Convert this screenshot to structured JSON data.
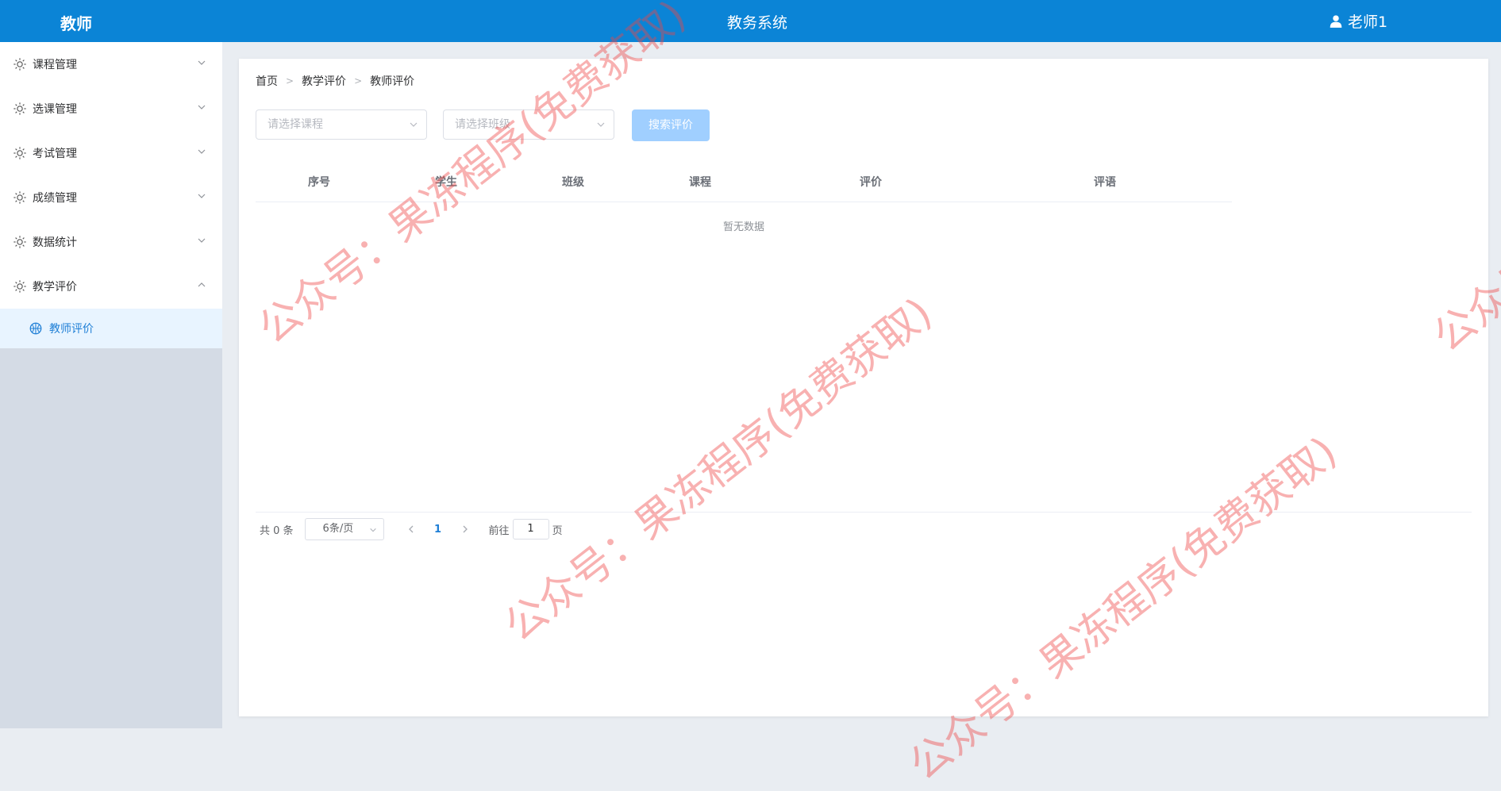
{
  "header": {
    "role_title": "教师",
    "system_title": "教务系统",
    "username": "老师1"
  },
  "sidebar": {
    "items": [
      {
        "label": "课程管理",
        "icon": "sun-icon",
        "expanded": false
      },
      {
        "label": "选课管理",
        "icon": "sun-icon",
        "expanded": false
      },
      {
        "label": "考试管理",
        "icon": "sun-icon",
        "expanded": false
      },
      {
        "label": "成绩管理",
        "icon": "sun-icon",
        "expanded": false
      },
      {
        "label": "数据统计",
        "icon": "sun-icon",
        "expanded": false
      },
      {
        "label": "教学评价",
        "icon": "sun-icon",
        "expanded": true
      }
    ],
    "sub_item": {
      "label": "教师评价",
      "icon": "basketball-icon"
    }
  },
  "breadcrumb": [
    "首页",
    "教学评价",
    "教师评价"
  ],
  "filters": {
    "course_placeholder": "请选择课程",
    "class_placeholder": "请选择班级",
    "search_label": "搜索评价"
  },
  "table": {
    "columns": [
      "序号",
      "学生",
      "班级",
      "课程",
      "评价",
      "评语"
    ],
    "empty_text": "暂无数据"
  },
  "pagination": {
    "total_text": "共 0 条",
    "page_size": "6条/页",
    "current_page": "1",
    "goto_prefix": "前往",
    "goto_value": "1",
    "goto_suffix": "页"
  },
  "watermark": {
    "text": "公众号：果冻程序(免费获取)"
  },
  "colors": {
    "header_bg": "#0b84d6",
    "accent": "#1f7fd6",
    "button_disabled": "#a0cfff",
    "watermark": "#ee4646"
  }
}
